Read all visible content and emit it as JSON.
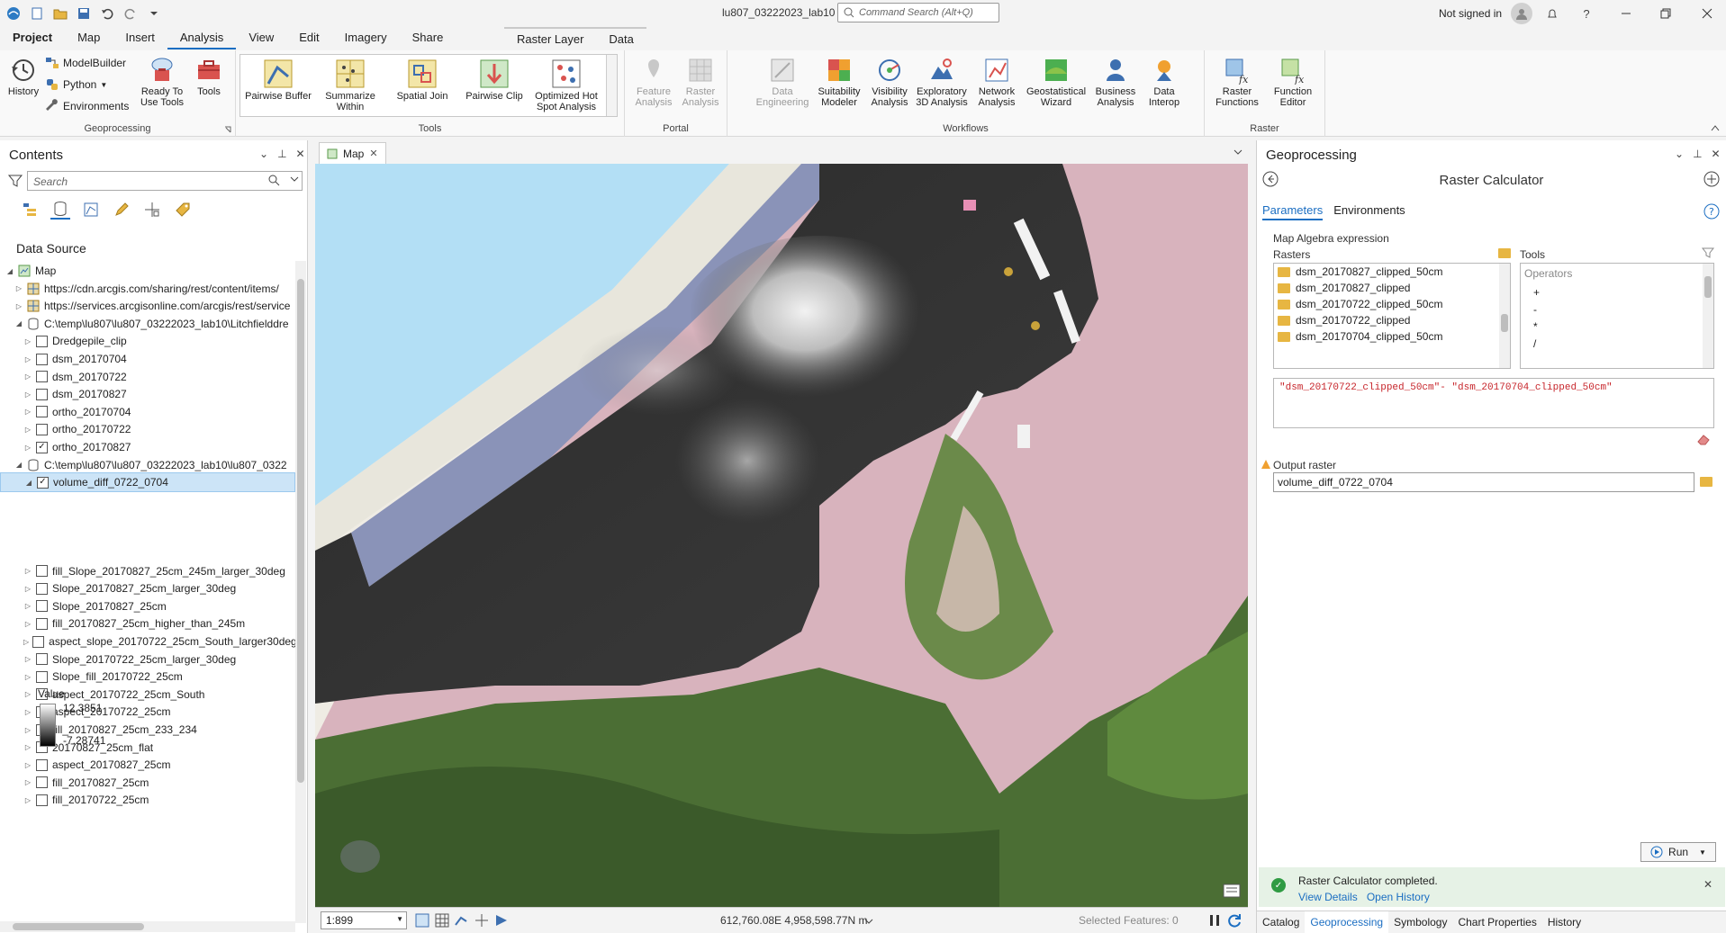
{
  "window": {
    "title": "lu807_03222023_lab10",
    "command_search_placeholder": "Command Search (Alt+Q)",
    "signin": "Not signed in"
  },
  "ribbon_tabs": [
    "Project",
    "Map",
    "Insert",
    "Analysis",
    "View",
    "Edit",
    "Imagery",
    "Share"
  ],
  "context_tabs": [
    "Raster Layer",
    "Data"
  ],
  "ribbon": {
    "geoprocessing": {
      "label": "Geoprocessing",
      "history": "History",
      "modelbuilder": "ModelBuilder",
      "python": "Python",
      "environments": "Environments",
      "ready_to_use": "Ready To Use Tools",
      "tools": "Tools"
    },
    "tools_group": {
      "label": "Tools",
      "items": [
        "Pairwise Buffer",
        "Summarize Within",
        "Spatial Join",
        "Pairwise Clip",
        "Optimized Hot Spot Analysis"
      ]
    },
    "portal_group": {
      "label": "Portal",
      "items": [
        "Feature Analysis",
        "Raster Analysis"
      ]
    },
    "workflows_group": {
      "label": "Workflows",
      "items": [
        "Data Engineering",
        "Suitability Modeler",
        "Visibility Analysis",
        "Exploratory 3D Analysis",
        "Network Analysis",
        "Geostatistical Wizard",
        "Business Analysis",
        "Data Interop"
      ]
    },
    "raster_group": {
      "label": "Raster",
      "items": [
        "Raster Functions",
        "Function Editor"
      ]
    }
  },
  "contents": {
    "title": "Contents",
    "search_placeholder": "Search",
    "section": "Data Source",
    "legend": {
      "title": "Value",
      "max": "12.3851",
      "min": "-7.28741"
    },
    "layers": [
      {
        "label": "Map",
        "indent": 0,
        "type": "map",
        "expanded": true
      },
      {
        "label": "https://cdn.arcgis.com/sharing/rest/content/items/",
        "indent": 1,
        "type": "web"
      },
      {
        "label": "https://services.arcgisonline.com/arcgis/rest/service",
        "indent": 1,
        "type": "web"
      },
      {
        "label": "C:\\temp\\lu807\\lu807_03222023_lab10\\Litchfielddre",
        "indent": 1,
        "type": "db",
        "expanded": true
      },
      {
        "label": "Dredgepile_clip",
        "indent": 2,
        "checked": false
      },
      {
        "label": "dsm_20170704",
        "indent": 2,
        "checked": false
      },
      {
        "label": "dsm_20170722",
        "indent": 2,
        "checked": false
      },
      {
        "label": "dsm_20170827",
        "indent": 2,
        "checked": false
      },
      {
        "label": "ortho_20170704",
        "indent": 2,
        "checked": false
      },
      {
        "label": "ortho_20170722",
        "indent": 2,
        "checked": false
      },
      {
        "label": "ortho_20170827",
        "indent": 2,
        "checked": true
      },
      {
        "label": "C:\\temp\\lu807\\lu807_03222023_lab10\\lu807_0322",
        "indent": 1,
        "type": "db",
        "expanded": true
      },
      {
        "label": "volume_diff_0722_0704",
        "indent": 2,
        "checked": true,
        "selected": true,
        "expanded": true
      },
      {
        "label": "fill_Slope_20170827_25cm_245m_larger_30deg",
        "indent": 2,
        "checked": false
      },
      {
        "label": "Slope_20170827_25cm_larger_30deg",
        "indent": 2,
        "checked": false
      },
      {
        "label": "Slope_20170827_25cm",
        "indent": 2,
        "checked": false
      },
      {
        "label": "fill_20170827_25cm_higher_than_245m",
        "indent": 2,
        "checked": false
      },
      {
        "label": "aspect_slope_20170722_25cm_South_larger30deg",
        "indent": 2,
        "checked": false
      },
      {
        "label": "Slope_20170722_25cm_larger_30deg",
        "indent": 2,
        "checked": false
      },
      {
        "label": "Slope_fill_20170722_25cm",
        "indent": 2,
        "checked": false
      },
      {
        "label": "aspect_20170722_25cm_South",
        "indent": 2,
        "checked": false
      },
      {
        "label": "aspect_20170722_25cm",
        "indent": 2,
        "checked": false
      },
      {
        "label": "fill_20170827_25cm_233_234",
        "indent": 2,
        "checked": false
      },
      {
        "label": "20170827_25cm_flat",
        "indent": 2,
        "checked": false
      },
      {
        "label": "aspect_20170827_25cm",
        "indent": 2,
        "checked": false
      },
      {
        "label": "fill_20170827_25cm",
        "indent": 2,
        "checked": false
      },
      {
        "label": "fill_20170722_25cm",
        "indent": 2,
        "checked": false
      }
    ]
  },
  "map": {
    "tab": "Map",
    "scale": "1:899",
    "coords": "612,760.08E 4,958,598.77N m",
    "selected_features": "Selected Features: 0"
  },
  "gp": {
    "title": "Geoprocessing",
    "tool": "Raster Calculator",
    "tabs": [
      "Parameters",
      "Environments"
    ],
    "map_algebra_label": "Map Algebra expression",
    "rasters_label": "Rasters",
    "tools_label": "Tools",
    "rasters": [
      "dsm_20170827_clipped_50cm",
      "dsm_20170827_clipped",
      "dsm_20170722_clipped_50cm",
      "dsm_20170722_clipped",
      "dsm_20170704_clipped_50cm"
    ],
    "operators_header": "Operators",
    "operators": [
      "+",
      "-",
      "*",
      "/"
    ],
    "expression": "\"dsm_20170722_clipped_50cm\"- \"dsm_20170704_clipped_50cm\"",
    "output_label": "Output raster",
    "output_value": "volume_diff_0722_0704",
    "run": "Run",
    "message": "Raster Calculator completed.",
    "view_details": "View Details",
    "open_history": "Open History",
    "bottom_tabs": [
      "Catalog",
      "Geoprocessing",
      "Symbology",
      "Chart Properties",
      "History"
    ]
  }
}
